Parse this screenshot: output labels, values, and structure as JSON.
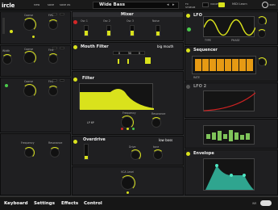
{
  "app": {
    "brand": "ircle"
  },
  "topbar": {
    "new_label": "new",
    "save_label": "save",
    "save_as_label": "save as",
    "preset_name": "Wide Bass",
    "prev_arrow": "◂",
    "next_arrow": "▸",
    "fx_label": "FX\nSTREAM",
    "voices_label": "VOICES",
    "midi_learn_label": "MIDI Learn",
    "about_label": "INDEX"
  },
  "osc1": {
    "labels": [
      "Coarse",
      "Fine"
    ],
    "spread_label": "Sync",
    "amp_label": "Amp"
  },
  "osc2": {
    "labels": [
      "Width",
      "Coarse",
      "Fine"
    ]
  },
  "osc3": {
    "labels": [
      "Coarse",
      "Fine"
    ]
  },
  "noise_panel": {
    "labels": [
      "Frequency",
      "Resonance"
    ]
  },
  "mixer": {
    "title": "Mixer",
    "channels": [
      "Osc 1",
      "Osc 2",
      "Osc 3",
      "Noise"
    ],
    "levels": [
      0.5,
      0.5,
      0.5,
      0.4
    ]
  },
  "mouth_filter": {
    "title": "Mouth Filter",
    "preset": "big mouth",
    "values": [
      "0",
      "50",
      "0"
    ]
  },
  "filter": {
    "title": "Filter",
    "type": "LP 6P",
    "labels": [
      "Frequency",
      "Resonance"
    ]
  },
  "overdrive": {
    "title": "Overdrive",
    "mode": "low boss",
    "labels": [
      "Drive",
      "tone"
    ]
  },
  "vca": {
    "label": "VCA Level"
  },
  "lfo": {
    "title": "LFO",
    "tabs": [
      "1",
      "2"
    ],
    "labels": [
      "TYPE",
      "PHASE"
    ],
    "sync_label": "SYNC"
  },
  "sequencer": {
    "title": "Sequencer",
    "rate_label": "RATE",
    "steps": 8
  },
  "lfo2": {
    "title": "LFO 2"
  },
  "envelope": {
    "title": "Envelope"
  },
  "bottom": {
    "tabs": [
      "Keyboard",
      "Settings",
      "Effects",
      "Control"
    ],
    "toggle_label": "WR"
  }
}
